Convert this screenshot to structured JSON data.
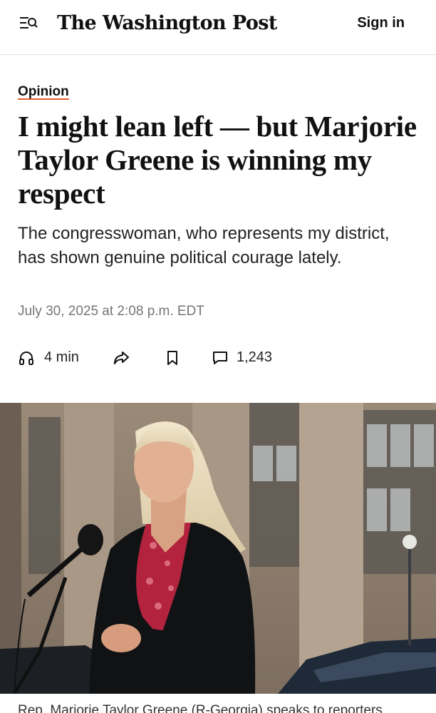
{
  "header": {
    "logo_text": "The Washington Post",
    "signin_label": "Sign in",
    "menu_icon": "menu-search-icon"
  },
  "article": {
    "kicker": "Opinion",
    "headline": "I might lean left — but Marjorie Taylor Greene is winning my respect",
    "dek": "The congresswoman, who represents my district, has shown genuine political courage lately.",
    "dateline": "July 30, 2025 at 2:08 p.m. EDT"
  },
  "actions": {
    "listen_label": "4 min",
    "listen_icon": "headphones-icon",
    "share_icon": "share-icon",
    "save_icon": "bookmark-icon",
    "comments_icon": "comment-icon",
    "comments_count": "1,243"
  },
  "photo": {
    "caption": "Rep. Marjorie Taylor Greene (R-Georgia) speaks to reporters"
  },
  "colors": {
    "kicker_underline": "#e15b2b",
    "dateline": "#767676"
  }
}
